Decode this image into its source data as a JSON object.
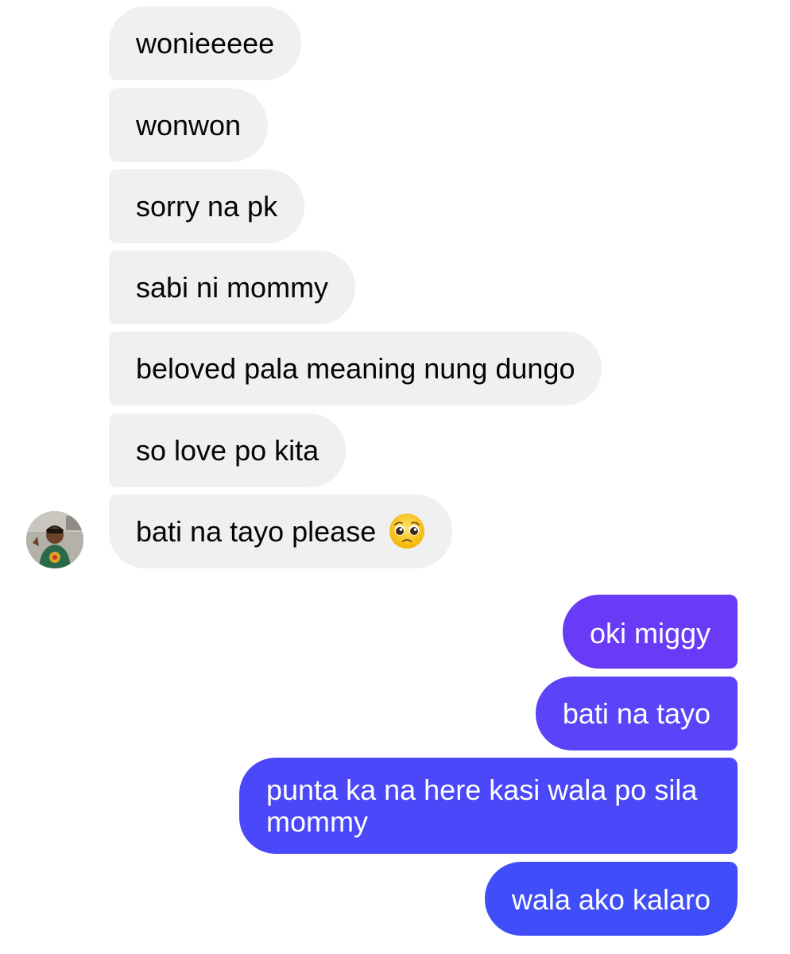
{
  "conversation": {
    "incoming": [
      {
        "text": "wonieeeee"
      },
      {
        "text": "wonwon"
      },
      {
        "text": "sorry na pk"
      },
      {
        "text": "sabi ni mommy"
      },
      {
        "text": "beloved pala meaning nung dungo"
      },
      {
        "text": "so love po kita"
      },
      {
        "text": "bati na tayo please",
        "emoji": "pleading-face-emoji"
      }
    ],
    "outgoing": [
      {
        "text": "oki miggy"
      },
      {
        "text": "bati na tayo"
      },
      {
        "text": "punta ka na here kasi wala po sila mommy"
      },
      {
        "text": "wala ako kalaro"
      }
    ]
  },
  "colors": {
    "incoming_bubble": "#f0f0f0",
    "outgoing_gradient_top": "#6a3bf7",
    "outgoing_gradient_bottom": "#3d4ff8"
  }
}
